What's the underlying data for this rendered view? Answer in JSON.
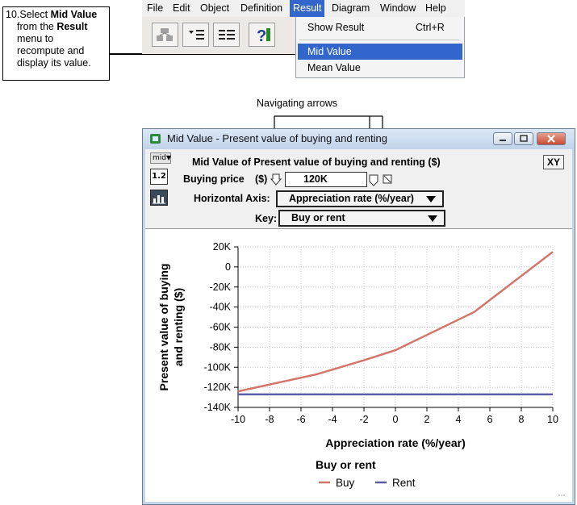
{
  "callout": {
    "line1_prefix": "10.Select ",
    "line1_bold": "Mid Value",
    "line2_prefix": "from the ",
    "line2_bold": "Result",
    "line3": "menu to",
    "line4": "recompute and",
    "line5": "display its value."
  },
  "menubar": {
    "items": [
      {
        "label": "File"
      },
      {
        "label": "Edit"
      },
      {
        "label": "Object"
      },
      {
        "label": "Definition"
      },
      {
        "label": "Result"
      },
      {
        "label": "Diagram"
      },
      {
        "label": "Window"
      },
      {
        "label": "Help"
      }
    ]
  },
  "result_menu": {
    "items": [
      {
        "label": "Show Result",
        "shortcut": "Ctrl+R"
      },
      {
        "label": "Mid Value",
        "shortcut": ""
      },
      {
        "label": "Mean Value",
        "shortcut": ""
      }
    ]
  },
  "annotation": {
    "navigating_arrows": "Navigating arrows"
  },
  "window": {
    "title": "Mid Value - Present value of buying and renting",
    "view_menu": "mid",
    "heading": "Mid Value of Present value of buying and renting ($)",
    "xy_button": "XY",
    "side_num_label": "1.2",
    "buying_price_label": "Buying price",
    "buying_price_unit": "($)",
    "buying_price_value": "120K",
    "horizontal_axis_label": "Horizontal Axis:",
    "horizontal_axis_value": "Appreciation rate (%/year)",
    "key_label": "Key:",
    "key_value": "Buy or rent"
  },
  "colors": {
    "buy": "#d4756b",
    "rent": "#5a5ea8",
    "menu_highlight": "#3366cc"
  },
  "chart_data": {
    "type": "line",
    "xlabel": "Appreciation rate (%/year)",
    "ylabel": "Present value of buying and renting ($)",
    "xlim": [
      -10,
      10
    ],
    "ylim": [
      -140000,
      20000
    ],
    "x_ticks": [
      "-10",
      "-8",
      "-6",
      "-4",
      "-2",
      "0",
      "2",
      "4",
      "6",
      "8",
      "10"
    ],
    "y_ticks": [
      "20K",
      "0",
      "-20K",
      "-40K",
      "-60K",
      "-80K",
      "-100K",
      "-120K",
      "-140K"
    ],
    "grid": true,
    "legend_title": "Buy or rent",
    "series": [
      {
        "name": "Buy",
        "x": [
          -10,
          -5,
          -2,
          0,
          5,
          10
        ],
        "y": [
          -124000,
          -107000,
          -93000,
          -83000,
          -45000,
          15000
        ]
      },
      {
        "name": "Rent",
        "x": [
          -10,
          10
        ],
        "y": [
          -127000,
          -127000
        ]
      }
    ]
  }
}
